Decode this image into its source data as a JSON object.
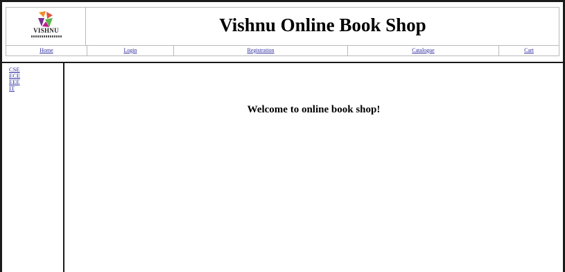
{
  "header": {
    "logo_text": "VISHNU",
    "title": "Vishnu Online Book Shop"
  },
  "nav": [
    "Home",
    "Login",
    "Registration",
    "Catalogue",
    "Cart"
  ],
  "sidebar": {
    "items": [
      "CSE",
      "ECE",
      "EEE",
      "IT"
    ]
  },
  "main": {
    "welcome": "Welcome to online book shop!"
  },
  "colors": {
    "link": "#2a2a9e",
    "logo_orange": "#f28c28",
    "logo_purple": "#7b2e8e",
    "logo_green": "#5bb74a"
  }
}
